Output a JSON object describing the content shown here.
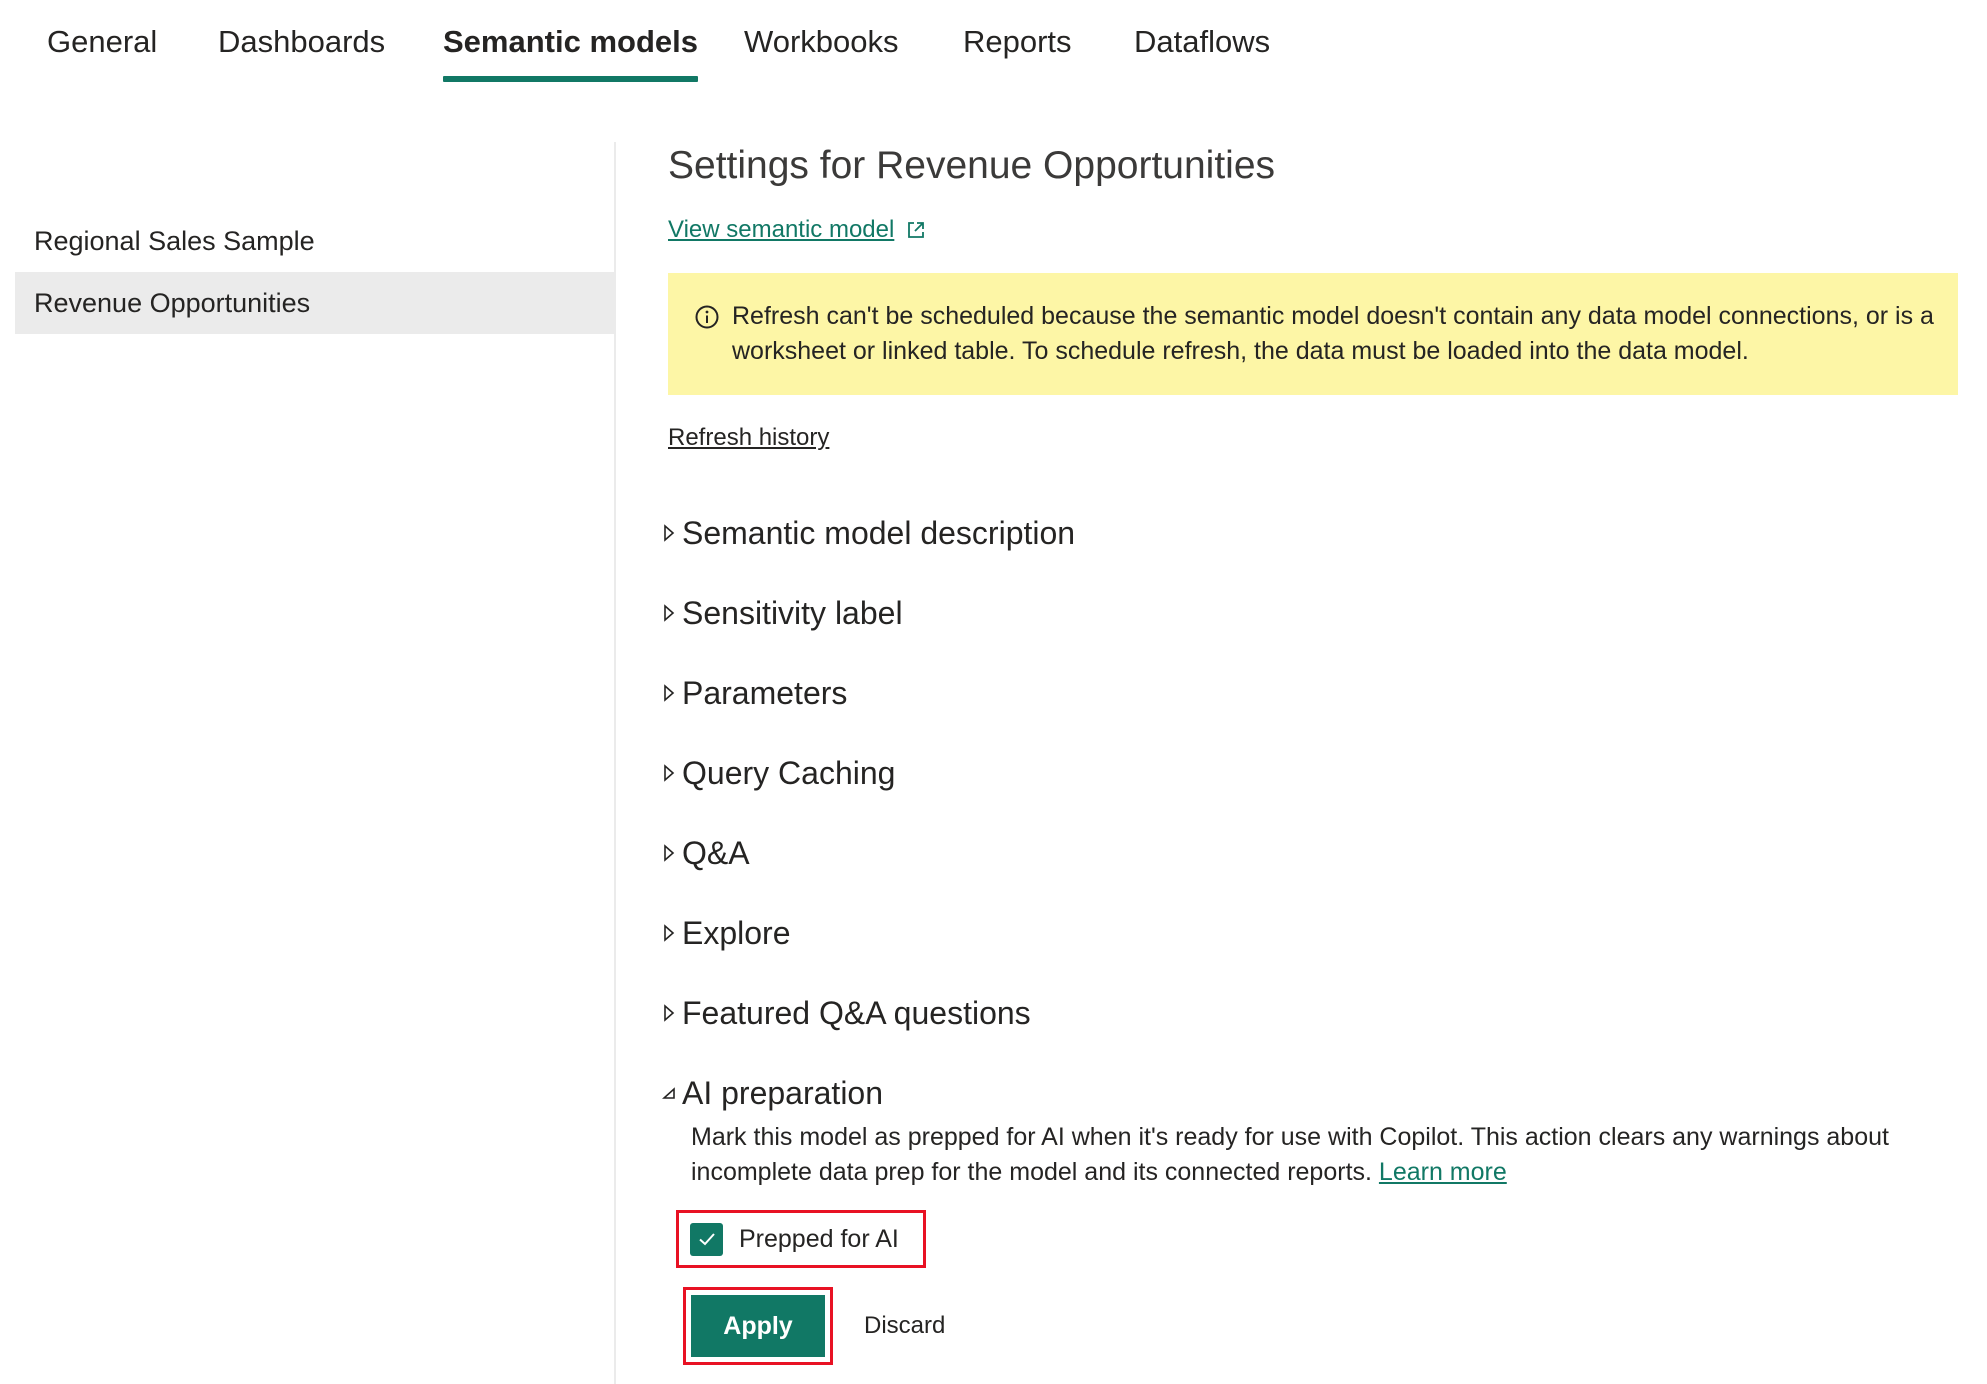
{
  "tabs": [
    {
      "label": "General"
    },
    {
      "label": "Dashboards"
    },
    {
      "label": "Semantic models"
    },
    {
      "label": "Workbooks"
    },
    {
      "label": "Reports"
    },
    {
      "label": "Dataflows"
    }
  ],
  "active_tab": "Semantic models",
  "models": [
    {
      "label": "Regional Sales Sample"
    },
    {
      "label": "Revenue Opportunities"
    }
  ],
  "selected_model": "Revenue Opportunities",
  "settings": {
    "title": "Settings for Revenue Opportunities",
    "view_link": "View semantic model",
    "banner": "Refresh can't be scheduled because the semantic model doesn't contain any data model connections, or is a worksheet or linked table. To schedule refresh, the data must be loaded into the data model.",
    "refresh_history": "Refresh history",
    "sections": [
      {
        "label": "Semantic model description",
        "expanded": false
      },
      {
        "label": "Sensitivity label",
        "expanded": false
      },
      {
        "label": "Parameters",
        "expanded": false
      },
      {
        "label": "Query Caching",
        "expanded": false
      },
      {
        "label": "Q&A",
        "expanded": false
      },
      {
        "label": "Explore",
        "expanded": false
      },
      {
        "label": "Featured Q&A questions",
        "expanded": false
      },
      {
        "label": "AI preparation",
        "expanded": true
      }
    ],
    "ai_prep": {
      "description": "Mark this model as prepped for AI when it's ready for use with Copilot. This action clears any warnings about incomplete data prep for the model and its connected reports.",
      "learn_more": "Learn more",
      "checkbox_label": "Prepped for AI",
      "checked": true,
      "apply_label": "Apply",
      "discard_label": "Discard"
    }
  },
  "colors": {
    "accent": "#117865",
    "banner_bg": "#fdf6a6",
    "highlight_border": "#e81123",
    "selected_bg": "#ebebeb"
  }
}
